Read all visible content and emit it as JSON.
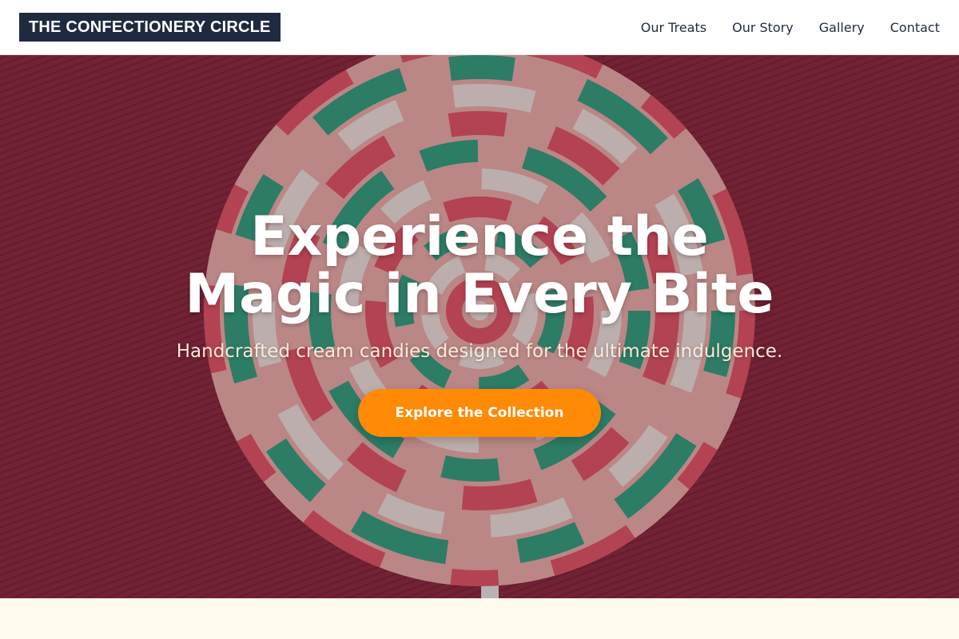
{
  "header": {
    "logo_text": "THE CONFECTIONERY CIRCLE",
    "nav": [
      {
        "label": "Our Treats"
      },
      {
        "label": "Our Story"
      },
      {
        "label": "Gallery"
      },
      {
        "label": "Contact"
      }
    ]
  },
  "hero": {
    "title_line1": "Experience the",
    "title_line2": "Magic in Every Bite",
    "subtitle": "Handcrafted cream candies designed for the ultimate indulgence.",
    "cta_label": "Explore the Collection",
    "background_image": "lollipop-swirl-photo"
  },
  "colors": {
    "header_bg": "#ffffff",
    "logo_bg": "#1f2a40",
    "nav_text": "#1f2a40",
    "hero_bg": "#8e2b40",
    "cta_bg": "#ff8a05",
    "page_bg": "#fffbee"
  }
}
